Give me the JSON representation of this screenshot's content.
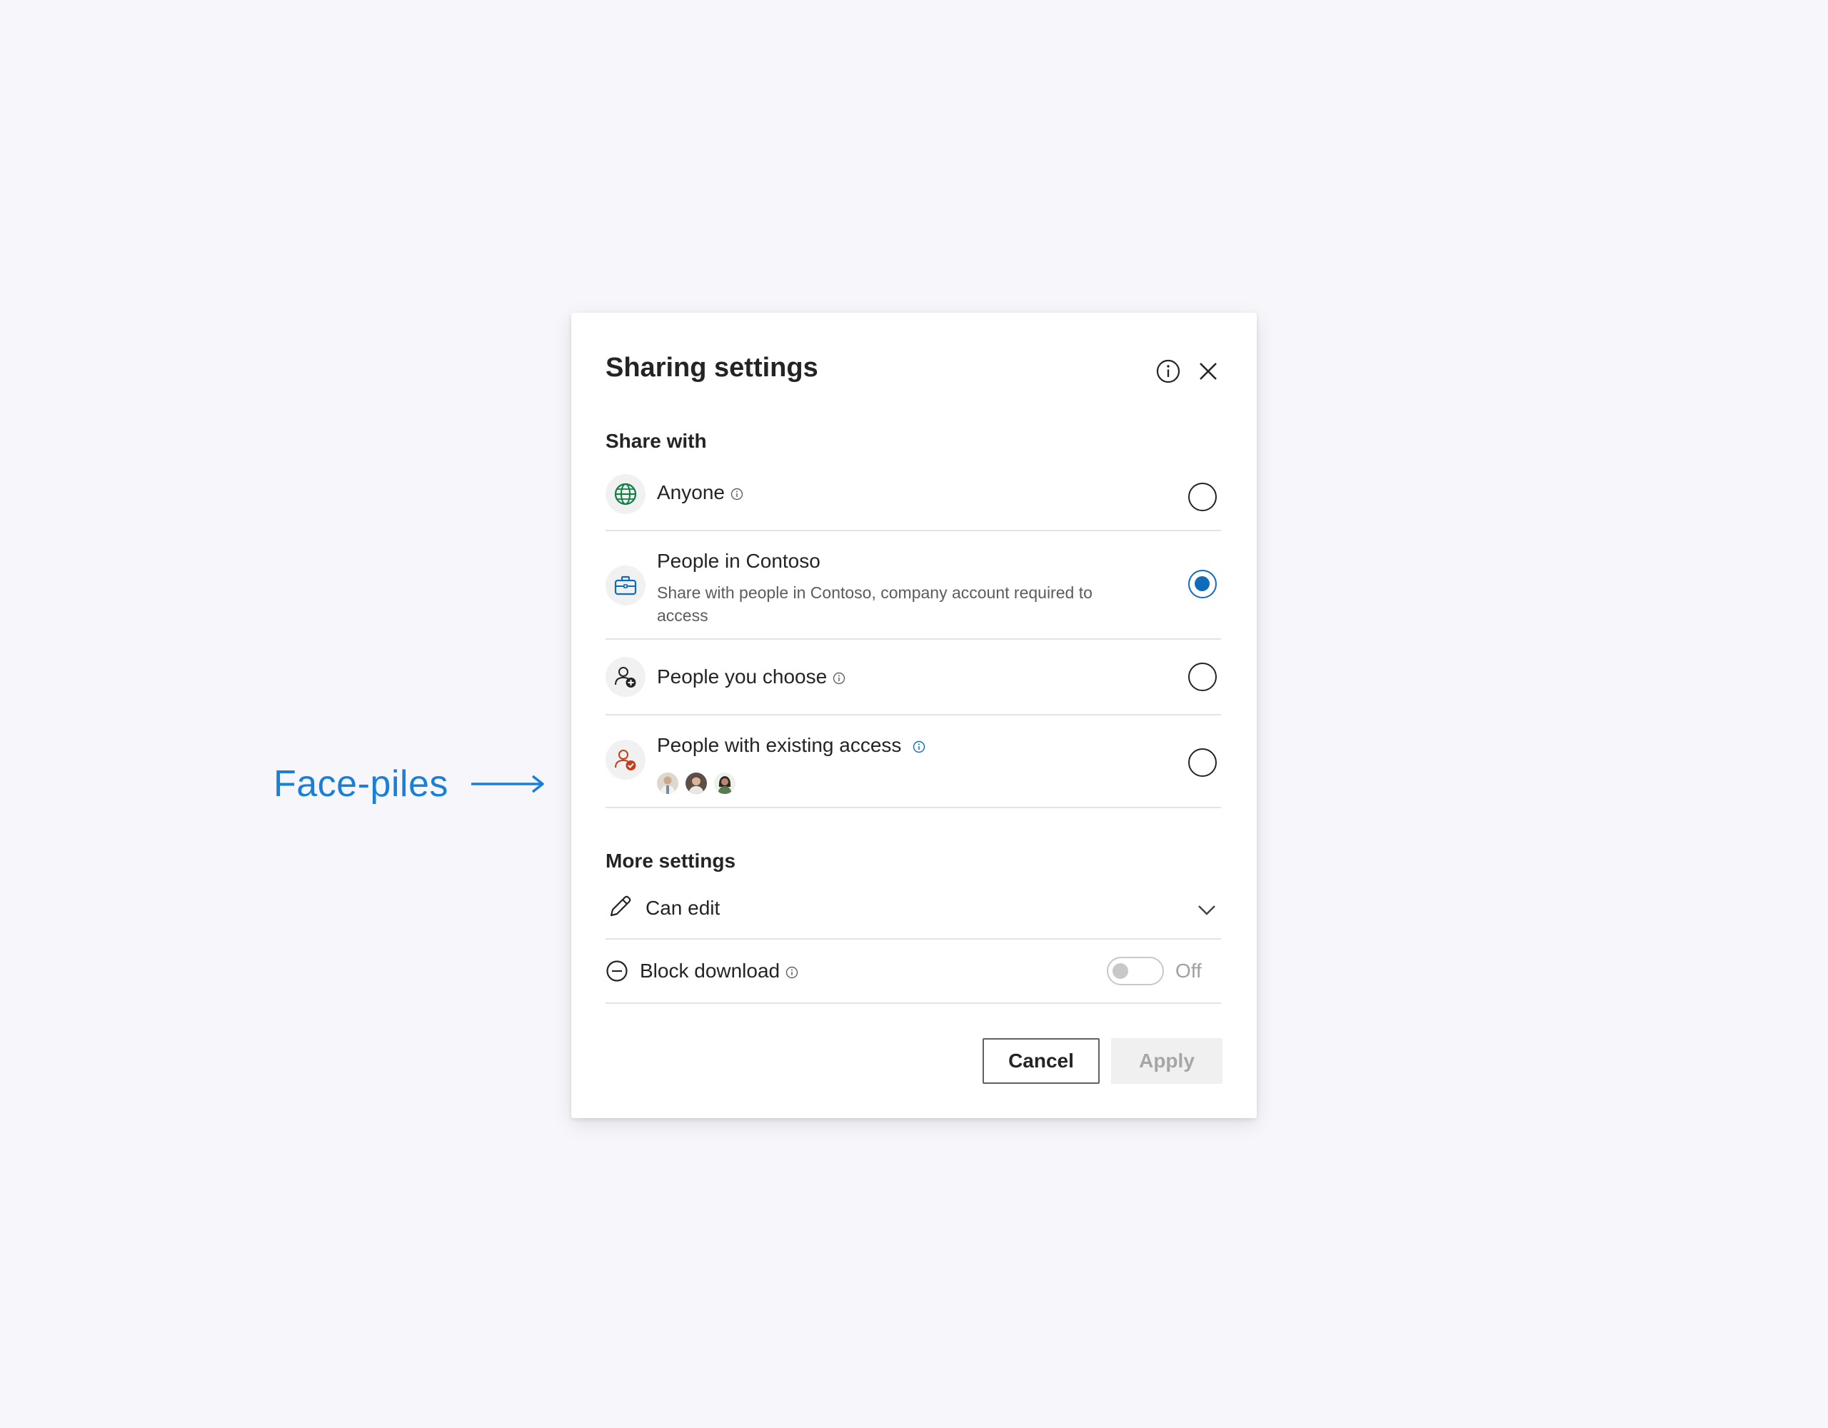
{
  "annotation": {
    "label": "Face-piles",
    "color": "#1a7fd6"
  },
  "dialog": {
    "title": "Sharing settings",
    "header_icons": [
      "info-icon",
      "close-icon"
    ]
  },
  "share_with": {
    "label": "Share with",
    "options": [
      {
        "label": "Anyone",
        "icon": "globe-icon",
        "has_info": true,
        "selected": false
      },
      {
        "label": "People in Contoso",
        "description": "Share with people in Contoso, company account required to access",
        "icon": "briefcase-icon",
        "has_info": false,
        "selected": true
      },
      {
        "label": "People you choose",
        "icon": "person-add-icon",
        "has_info": true,
        "selected": false
      },
      {
        "label": "People with existing access",
        "icon": "person-check-icon",
        "has_info": true,
        "selected": false,
        "face_pile": [
          "avatar-1",
          "avatar-2",
          "avatar-3"
        ]
      }
    ]
  },
  "more_settings": {
    "label": "More settings",
    "permission": {
      "label": "Can edit",
      "icon": "pencil-icon"
    },
    "block_download": {
      "label": "Block download",
      "icon": "block-icon",
      "toggle_state": "Off",
      "enabled": false
    }
  },
  "actions": {
    "cancel_label": "Cancel",
    "apply_label": "Apply"
  },
  "colors": {
    "accent": "#0f6cbd",
    "globe": "#107c41",
    "briefcase": "#0f6cbd",
    "existing_access": "#c43e1c"
  }
}
